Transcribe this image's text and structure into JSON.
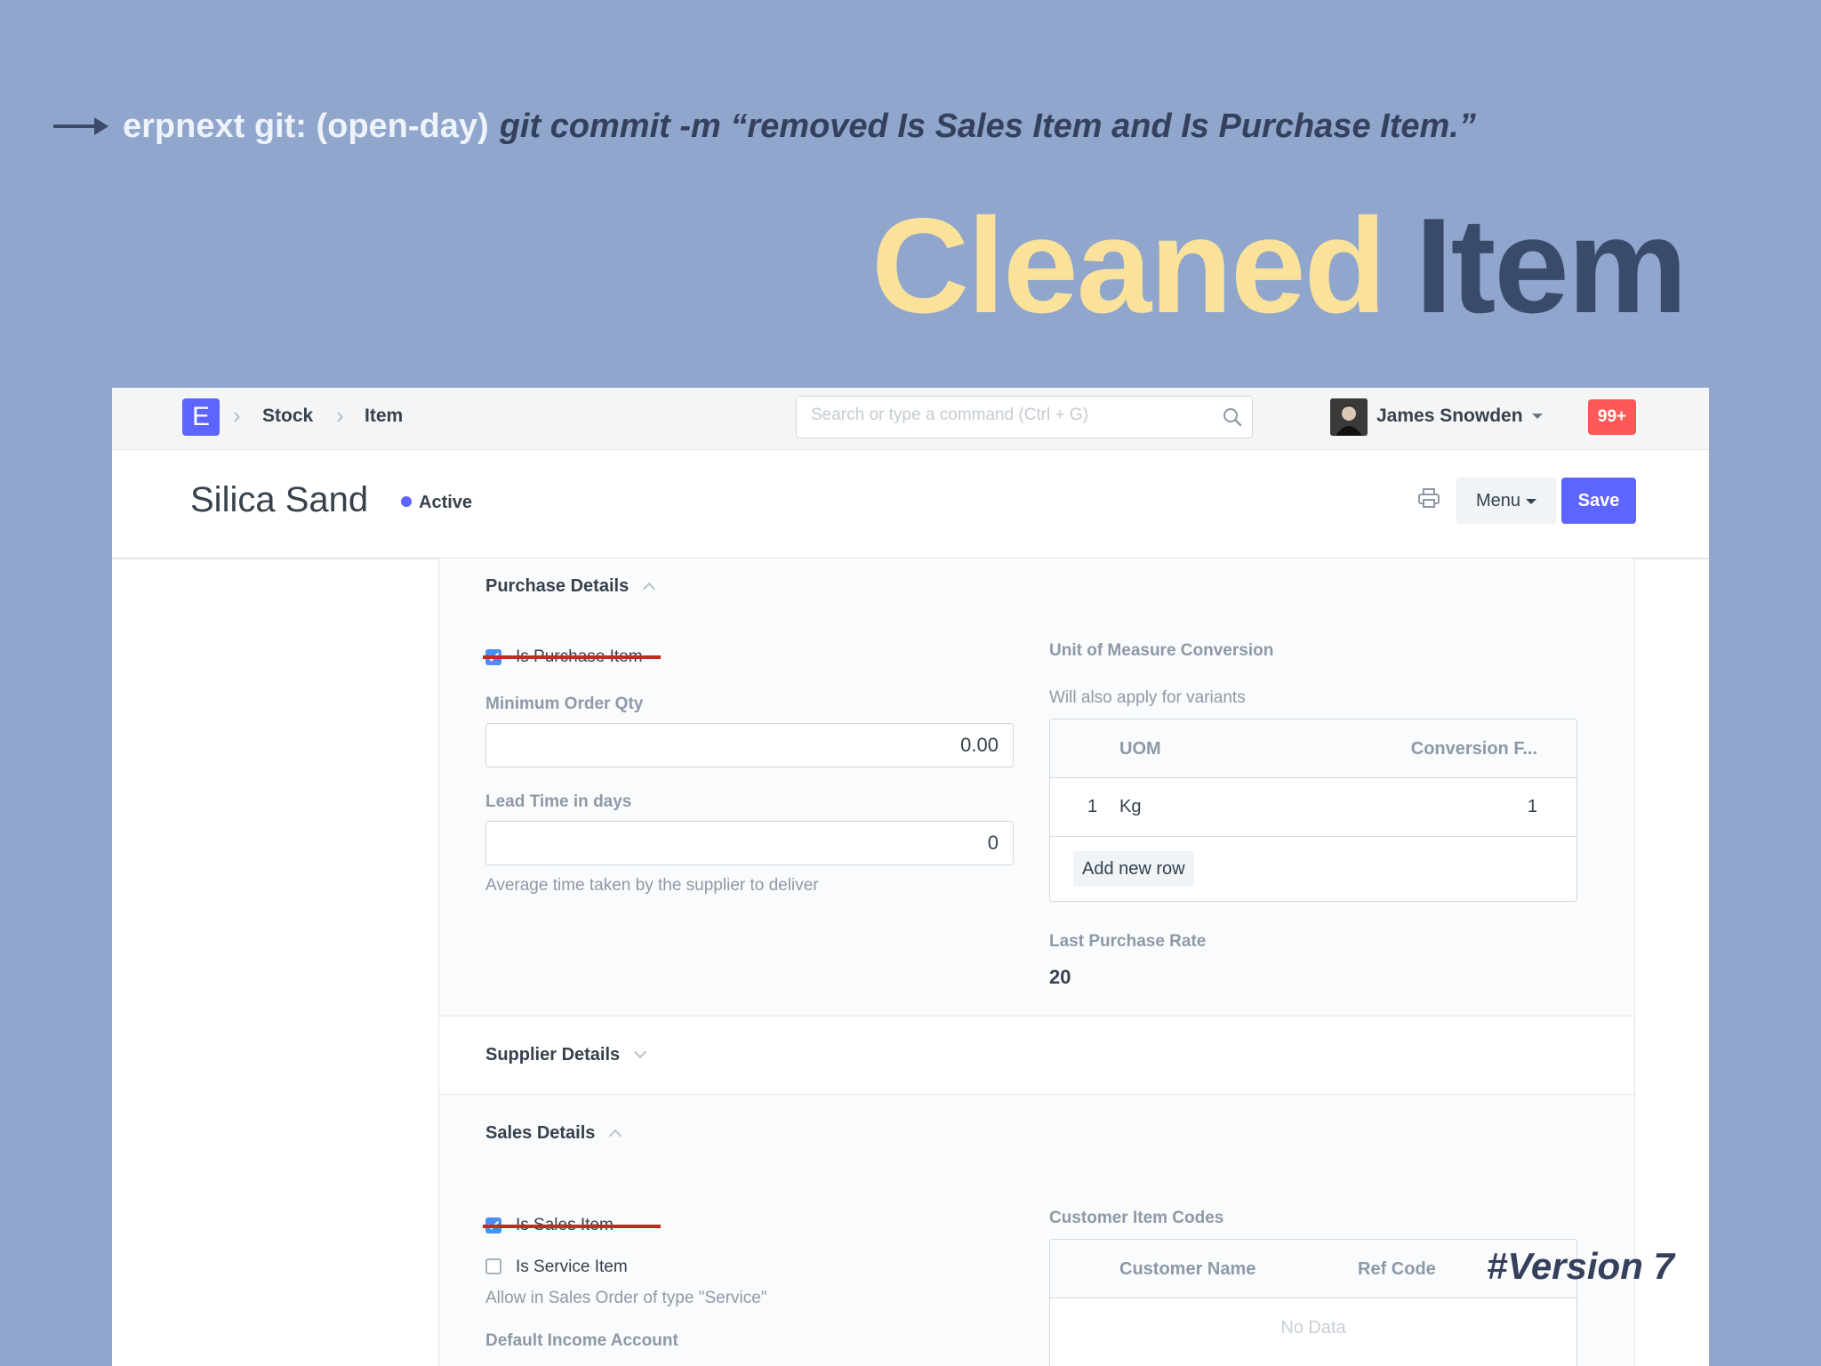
{
  "slide": {
    "command_prompt": "erpnext git: (open-day)",
    "command": "git commit -m “removed Is Sales Item and Is Purchase Item.”",
    "headline_word1": "Cleaned",
    "headline_word2": "Item",
    "version_tag": "#Version 7",
    "colors": {
      "background": "#90a6cc",
      "headline_highlight": "#fbe29a",
      "headline_dark": "#3a4a6a",
      "strike": "#c32b20"
    }
  },
  "navbar": {
    "logo_letter": "E",
    "breadcrumbs": [
      "Stock",
      "Item"
    ],
    "search_placeholder": "Search or type a command (Ctrl + G)",
    "user_name": "James Snowden",
    "notifications": "99+",
    "icons": {
      "search": "search-icon",
      "caret": "caret-down-icon"
    }
  },
  "page": {
    "title": "Silica Sand",
    "status": "Active",
    "menu_label": "Menu",
    "save_label": "Save",
    "accent": "#5e64ff",
    "icons": {
      "print": "printer-icon"
    }
  },
  "purchase": {
    "heading": "Purchase Details",
    "is_purchase_item": {
      "label": "Is Purchase Item",
      "checked": true
    },
    "min_order_qty": {
      "label": "Minimum Order Qty",
      "value": "0.00"
    },
    "lead_time": {
      "label": "Lead Time in days",
      "value": "0",
      "description": "Average time taken by the supplier to deliver"
    },
    "uom": {
      "label": "Unit of Measure Conversion",
      "description": "Will also apply for variants",
      "columns": [
        "UOM",
        "Conversion F..."
      ],
      "rows": [
        {
          "idx": "1",
          "uom": "Kg",
          "factor": "1"
        }
      ],
      "add_row": "Add new row"
    },
    "last_purchase_rate": {
      "label": "Last Purchase Rate",
      "value": "20"
    }
  },
  "supplier": {
    "heading": "Supplier Details"
  },
  "sales": {
    "heading": "Sales Details",
    "is_sales_item": {
      "label": "Is Sales Item",
      "checked": true
    },
    "is_service_item": {
      "label": "Is Service Item",
      "checked": false,
      "description": "Allow in Sales Order of type \"Service\""
    },
    "default_income_account": {
      "label": "Default Income Account"
    },
    "customer_codes": {
      "label": "Customer Item Codes",
      "columns": [
        "Customer Name",
        "Ref Code"
      ],
      "empty": "No Data"
    }
  }
}
